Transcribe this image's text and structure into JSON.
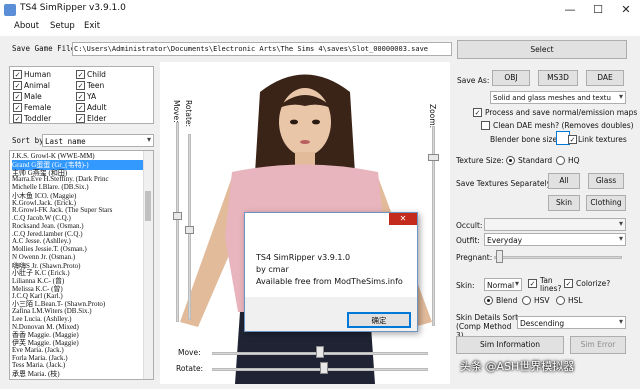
{
  "window": {
    "title": "TS4 SimRipper v3.9.1.0",
    "minimize": "—",
    "maximize": "☐",
    "close": "✕"
  },
  "menu": [
    "About",
    "Setup",
    "Exit"
  ],
  "save_file": {
    "label": "Save Game File:",
    "path": "C:\\Users\\Administrator\\Documents\\Electronic Arts\\The Sims 4\\saves\\Slot_00000003.save",
    "select_label": "Select"
  },
  "filters": {
    "left": [
      {
        "label": "Human",
        "checked": true
      },
      {
        "label": "Animal",
        "checked": true
      },
      {
        "label": "Male",
        "checked": true
      },
      {
        "label": "Female",
        "checked": true
      },
      {
        "label": "Toddler",
        "checked": true
      }
    ],
    "right": [
      {
        "label": "Child",
        "checked": true
      },
      {
        "label": "Teen",
        "checked": true
      },
      {
        "label": "YA",
        "checked": true
      },
      {
        "label": "Adult",
        "checked": true
      },
      {
        "label": "Elder",
        "checked": true
      }
    ]
  },
  "sort": {
    "label": "Sort by:",
    "value": "Last name"
  },
  "sims": [
    "J.K.S. Growl-K (WWE-MM)",
    "Grand G蛋蛋 (Gr_(韦特)-)",
    "主帅 G燕玺 (和田)",
    "Marra.Eve H.Steffiny. (Dark Princ",
    "Michelle I.Blare. (DB.Six.)",
    "小木鱼 ICO. (Maggie)",
    "K.Growl.Jack. (Erick.)",
    "R.Growl-FK Jack. (The Super Stars",
    ".C.Q Jacob.W (C.Q.)",
    "Rocksand Jean. (Osman.)",
    ".C.Q Jered.lamber (C.Q.)",
    "A.C Jesse. (Ashlley.)",
    "Mollies Jessie.T. (Osman.)",
    "N Owenn Jr. (Osman.)",
    "嗨嗨S Jr. (Shawn.Proto)",
    "小肚子 K.C (Erick.)",
    "Lilianna K.C- (曾)",
    "Melissa K.C- (曾)",
    "J.C.Q Karl (Karl.)",
    "小三陌 L.Bean.T- (Shawn.Proto)",
    "Zafina LM.Witers (DB.Six.)",
    "Lee Lucia. (Ashlley.)",
    "N.Donovan M. (Mixed)",
    "香香 Maggie. (Maggie)",
    "伊芙 Maggie. (Maggie)",
    "Eve Maria. (Jack.)",
    "Forla Maria. (Jack.)",
    "Tess Maria. (Jack.)",
    "承恩 Maria. (枝)"
  ],
  "viewport": {
    "move_label": "Move:",
    "rotate_label": "Rotate:",
    "zoom_label": "Zoom:"
  },
  "save_as": {
    "label": "Save As:",
    "buttons": [
      "OBJ",
      "MS3D",
      "DAE"
    ],
    "mesh_option": "Solid and glass meshes and textu"
  },
  "options": {
    "process_maps": {
      "label": "Process and save normal/emission maps",
      "checked": true
    },
    "clean_dae": {
      "label": "Clean DAE mesh? (Removes doubles)",
      "checked": false
    },
    "blender_bone_size": {
      "label": "Blender bone size"
    },
    "link_textures": {
      "label": "Link textures",
      "checked": true
    }
  },
  "texture_size": {
    "label": "Texture Size:",
    "options": [
      {
        "label": "Standard",
        "selected": true
      },
      {
        "label": "HQ",
        "selected": false
      }
    ]
  },
  "save_textures": {
    "label": "Save Textures Separately:",
    "buttons": [
      "All",
      "Glass",
      "Skin",
      "Clothing"
    ]
  },
  "occult": {
    "label": "Occult:",
    "value": ""
  },
  "outfit": {
    "label": "Outfit:",
    "value": "Everyday"
  },
  "pregnant": {
    "label": "Pregnant:",
    "value": 0
  },
  "skin": {
    "label": "Skin:",
    "value": "Normal",
    "tan_lines": {
      "label": "Tan lines?",
      "checked": true
    },
    "colorize": {
      "label": "Colorize?",
      "checked": true
    }
  },
  "blend_modes": [
    {
      "label": "Blend",
      "selected": true
    },
    {
      "label": "HSV",
      "selected": false
    },
    {
      "label": "HSL",
      "selected": false
    }
  ],
  "sim_details": {
    "label": "Skin Details Sort (Comp Method 3)",
    "value": "Descending"
  },
  "bottom_buttons": {
    "sim_information": "Sim Information",
    "sim_error": "Sim Error"
  },
  "watermark": "头条 @ASH世界模拟器",
  "dialog": {
    "title": "",
    "line1": "TS4 SimRipper v3.9.1.0",
    "line2": "by cmar",
    "line3": "Available free from ModTheSims.info",
    "ok": "确定",
    "close": "✕"
  },
  "colors": {
    "selection": "#3399ff",
    "accent_border": "#0078d7",
    "shirt": "#e8b4bd"
  }
}
